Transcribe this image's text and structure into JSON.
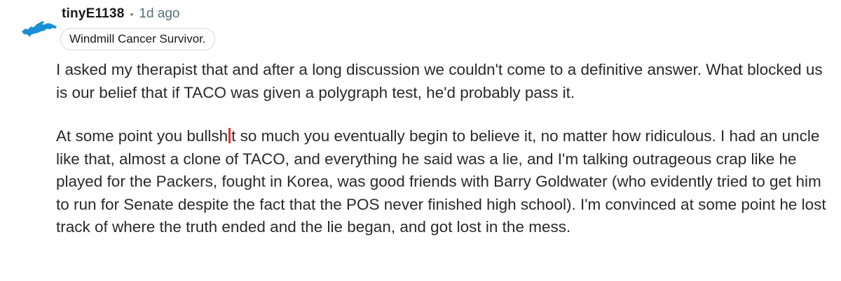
{
  "comment": {
    "username": "tinyE1138",
    "separator": "•",
    "timestamp": "1d ago",
    "flair": "Windmill Cancer Survivor.",
    "avatar_icon": "michigan-upper-peninsula-map-icon",
    "avatar_color": "#1a8fd6",
    "cursor_color": "#e3342f",
    "paragraphs": [
      "I asked my therapist that and after a long discussion we couldn't come to a definitive answer. What blocked us is our belief that if TACO was given a polygraph test, he'd probably pass it.",
      "At some point you bullsh",
      "t so much you eventually begin to believe it, no matter how ridiculous. I had an uncle like that, almost a clone of TACO, and everything he said was a lie, and I'm talking outrageous crap like he played for the Packers, fought in Korea, was good friends with Barry Goldwater (who evidently tried to get him to run for Senate despite the fact that the POS never finished high school). I'm convinced at some point he lost track of where the truth ended and the lie began, and got lost in the mess."
    ]
  }
}
